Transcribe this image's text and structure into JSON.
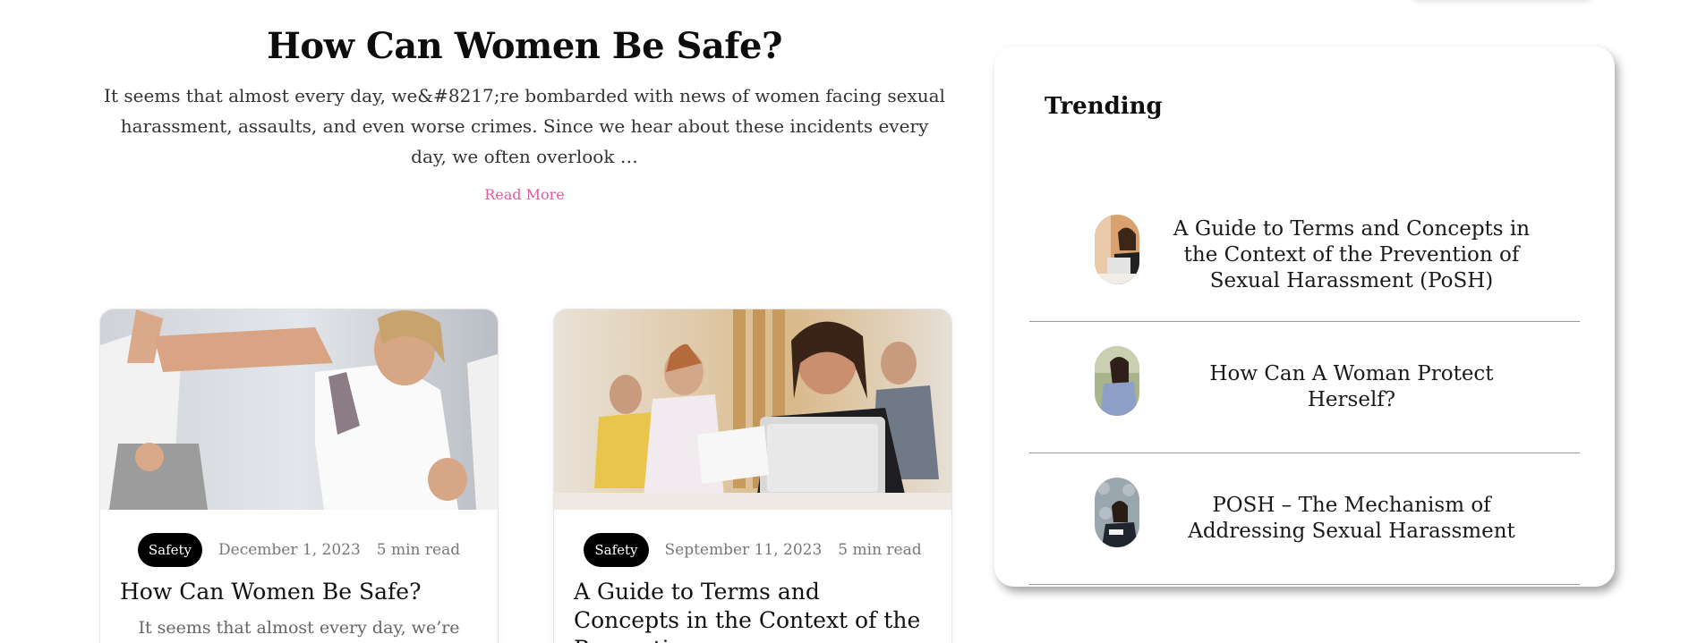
{
  "featured": {
    "title": "How Can Women Be Safe?",
    "excerpt": "It seems that almost every day, we&#8217;re bombarded with news of women facing sexual harassment, assaults, and even worse crimes. Since we hear about these incidents every day, we often overlook …",
    "read_more": "Read More",
    "link_color": "#e25a9c"
  },
  "cards": [
    {
      "tag": "Safety",
      "date": "December 1, 2023",
      "read_time": "5 min read",
      "title": "How Can Women Be Safe?",
      "excerpt": "It seems that almost every day, we’re",
      "image_icon": "woman-boxing-photo"
    },
    {
      "tag": "Safety",
      "date": "September 11, 2023",
      "read_time": "5 min read",
      "title": "A Guide to Terms and Concepts in the Context of the Prevention",
      "excerpt": "",
      "image_icon": "woman-laptop-office-photo"
    }
  ],
  "trending": {
    "heading": "Trending",
    "items": [
      {
        "title": "A Guide to Terms and Concepts in the Context of the Prevention of Sexual Harassment (PoSH)",
        "thumb_icon": "woman-laptop-thumb"
      },
      {
        "title": "How Can A Woman Protect Herself?",
        "thumb_icon": "woman-portrait-thumb"
      },
      {
        "title": "POSH – The Mechanism of Addressing Sexual Harassment",
        "thumb_icon": "woman-office-thumb"
      }
    ]
  }
}
